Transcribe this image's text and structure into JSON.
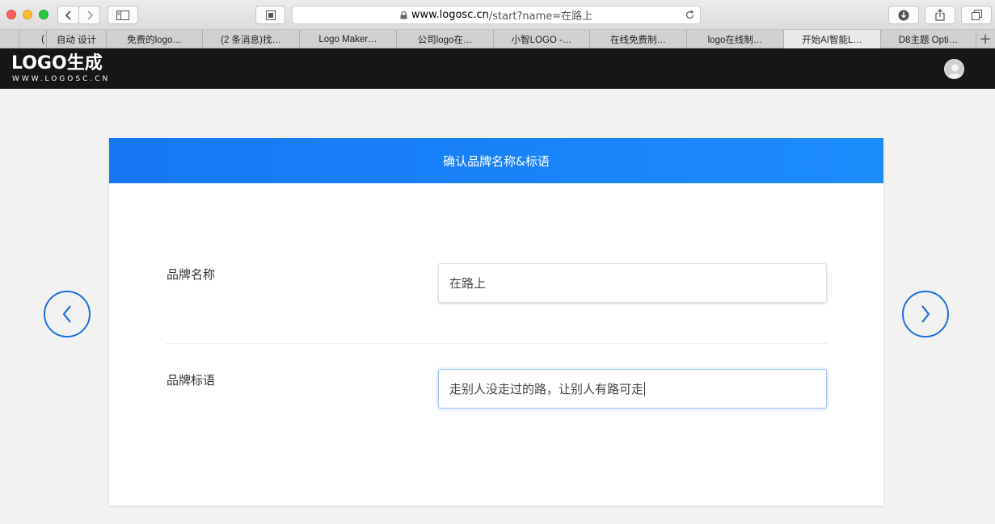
{
  "browser": {
    "url_host": "www.logosc.cn",
    "url_path": "/start?name=在路上",
    "tabs": [
      {
        "label": "(",
        "active": false
      },
      {
        "label": "自动 设计",
        "active": false
      },
      {
        "label": "免费的logo…",
        "active": false
      },
      {
        "label": "(2 条消息)找…",
        "active": false
      },
      {
        "label": "Logo Maker…",
        "active": false
      },
      {
        "label": "公司logo在…",
        "active": false
      },
      {
        "label": "小智LOGO -…",
        "active": false
      },
      {
        "label": "在线免费制…",
        "active": false
      },
      {
        "label": "logo在线制…",
        "active": false
      },
      {
        "label": "开始AI智能L…",
        "active": true
      },
      {
        "label": "D8主题 Opti…",
        "active": false
      }
    ],
    "new_tab_label": "+"
  },
  "site": {
    "logo_text": "LOGO生成",
    "logo_sub": "WWW.LOGOSC.CN"
  },
  "card": {
    "title": "确认品牌名称&标语",
    "brand_name_label": "品牌名称",
    "brand_name_value": "在路上",
    "slogan_label": "品牌标语",
    "slogan_value": "走别人没走过的路，让别人有路可走"
  },
  "colors": {
    "header_bg": "#161616",
    "card_head_blue": "#1677f6",
    "arrow_blue": "#1a6fe0"
  }
}
